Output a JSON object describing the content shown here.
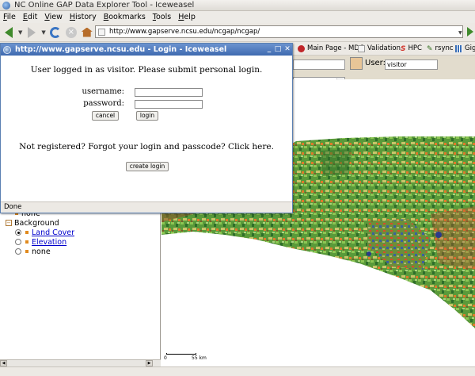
{
  "window": {
    "title": "NC Online GAP Data Explorer Tool - Iceweasel"
  },
  "menu": [
    "File",
    "Edit",
    "View",
    "History",
    "Bookmarks",
    "Tools",
    "Help"
  ],
  "nav": {
    "url": "http://www.gapserve.ncsu.edu/ncgap/ncgap/"
  },
  "bookmarks": [
    {
      "label": "Main Page - MDC",
      "icon": "mdc-icon",
      "color": "#c0262a"
    },
    {
      "label": "Validation",
      "icon": "page-icon",
      "color": "#dddddd"
    },
    {
      "label": "HPC",
      "icon": "hpc-icon",
      "color": "#d1342b"
    },
    {
      "label": "rsync",
      "icon": "rsync-icon",
      "color": "#2f6e1b"
    },
    {
      "label": "Giga",
      "icon": "grid-icon",
      "color": "#3a6fb8"
    }
  ],
  "app": {
    "user_label": "User:",
    "user_value": "visitor"
  },
  "tree": {
    "none_top": "none",
    "background_label": "Background",
    "items": [
      {
        "label": "Land Cover",
        "checked": true,
        "link": true
      },
      {
        "label": "Elevation",
        "checked": false,
        "link": true
      },
      {
        "label": "none",
        "checked": false,
        "link": false
      }
    ]
  },
  "map": {
    "scale_zero": "0",
    "scale_km": "55 km"
  },
  "popup": {
    "title": "http://www.gapserve.ncsu.edu - Login - Iceweasel",
    "message": "User logged in as visitor. Please submit personal login.",
    "username_label": "username:",
    "password_label": "password:",
    "cancel_label": "cancel",
    "login_label": "login",
    "notice": "Not registered? Forgot your login and passcode? Click here.",
    "create_label": "create login",
    "status": "Done"
  },
  "colors": {
    "accent": "#3e6ab0",
    "toolbar": "#ece9e4",
    "link": "#0000cc"
  }
}
